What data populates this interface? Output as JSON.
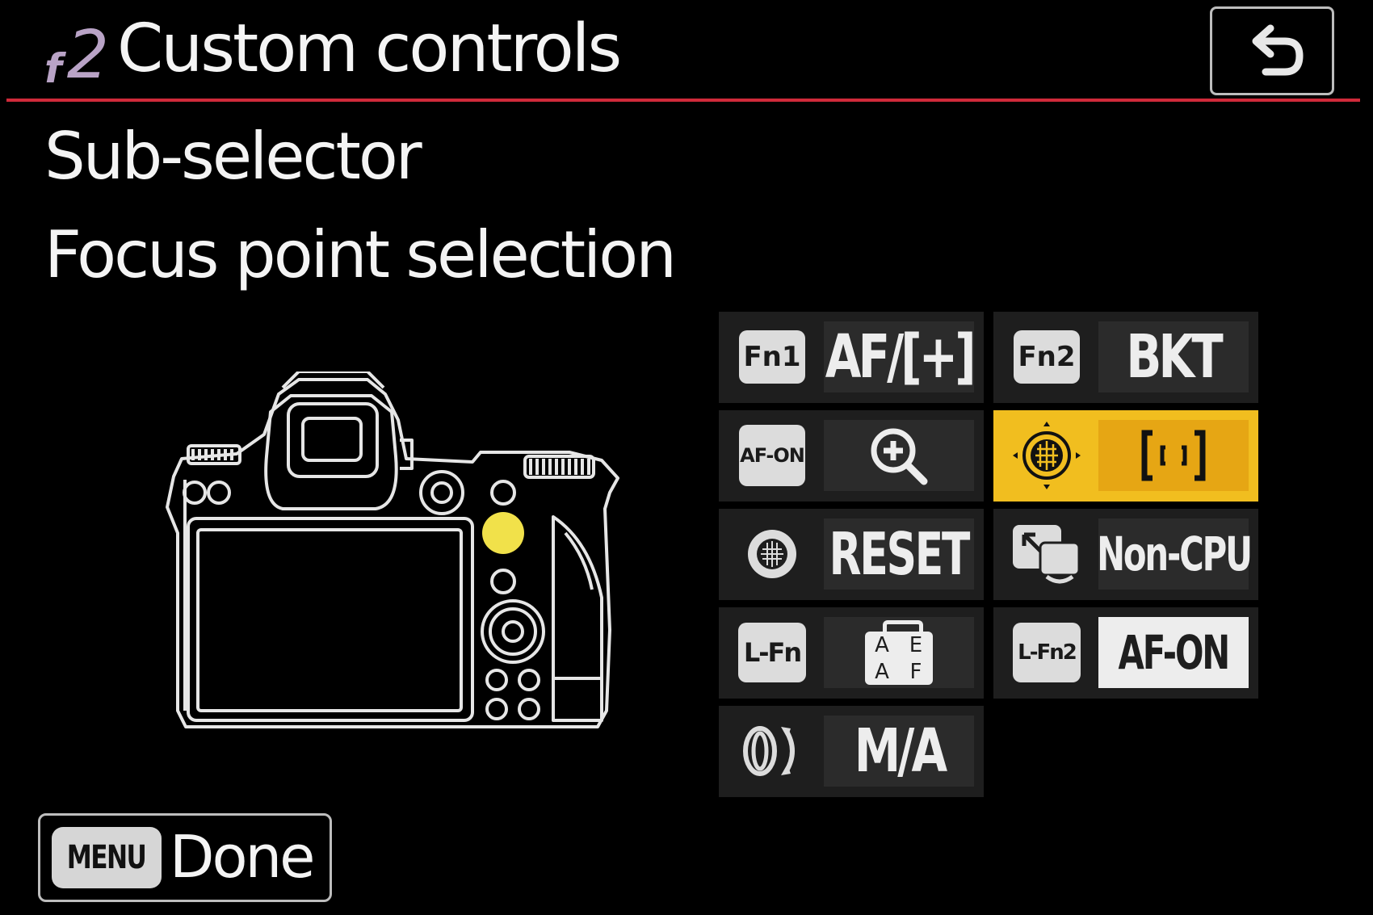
{
  "header": {
    "code_letter": "f",
    "code_number": "2",
    "title": "Custom controls"
  },
  "control": {
    "name": "Sub-selector",
    "assigned_function": "Focus point selection"
  },
  "tiles": [
    {
      "icon": "fn1-button-icon",
      "key_label": "Fn1",
      "value": "AF/[+]"
    },
    {
      "icon": "fn2-button-icon",
      "key_label": "Fn2",
      "value": "BKT"
    },
    {
      "icon": "af-on-button-icon",
      "key_label": "AF-ON",
      "value": "zoom-in-icon"
    },
    {
      "icon": "sub-selector-icon",
      "key_label": "",
      "value": "focus-point-icon",
      "selected": true
    },
    {
      "icon": "sub-selector-center-icon",
      "key_label": "",
      "value": "RESET"
    },
    {
      "icon": "lens-fn-button-icon",
      "key_label": "",
      "value": "Non-CPU"
    },
    {
      "icon": "l-fn-button-icon",
      "key_label": "L-Fn",
      "value": "ae-af-lock-icon",
      "value_text": [
        "A",
        "E",
        "A",
        "F"
      ]
    },
    {
      "icon": "l-fn2-button-icon",
      "key_label": "L-Fn2",
      "value": "AF-ON"
    },
    {
      "icon": "focus-ring-icon",
      "key_label": "",
      "value": "M/A"
    }
  ],
  "footer": {
    "menu_key": "MENU",
    "done_label": "Done"
  },
  "colors": {
    "background": "#000000",
    "header_rule": "#d02a3a",
    "selection": "#f1be1f",
    "highlighted_control": "#f1e14a",
    "code_purple": "#b9a3c6"
  }
}
